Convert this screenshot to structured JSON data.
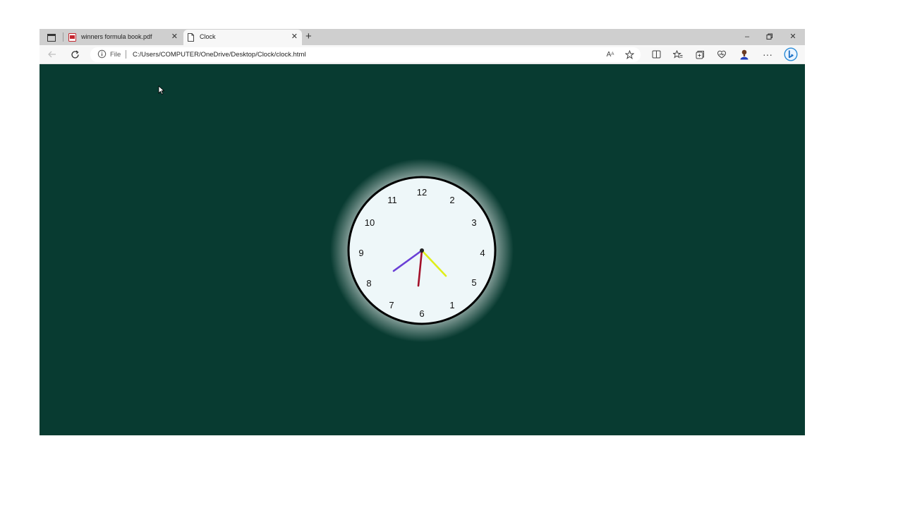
{
  "browser": {
    "tabs": [
      {
        "label": "winners formula book.pdf",
        "icon": "pdf-icon",
        "active": false
      },
      {
        "label": "Clock",
        "icon": "page-icon",
        "active": true
      }
    ],
    "new_tab_icon": "plus-icon",
    "address": {
      "scheme_label": "File",
      "url": "C:/Users/COMPUTER/OneDrive/Desktop/Clock/clock.html"
    },
    "toolbar_icons": [
      "back-icon",
      "refresh-icon",
      "read-aloud-icon",
      "favorite-star-icon",
      "split-screen-icon",
      "favorites-icon",
      "collections-icon",
      "browser-essentials-icon",
      "profile-icon",
      "more-icon",
      "bing-icon"
    ]
  },
  "page": {
    "background_color": "#083b31",
    "clock": {
      "face_color": "#eef7f9",
      "rim_color": "#000000",
      "numerals": [
        "12",
        "1",
        "2",
        "3",
        "4",
        "5",
        "6",
        "7",
        "8",
        "9",
        "10",
        "11"
      ],
      "hands": [
        {
          "name": "hour",
          "color": "#6a3fd6"
        },
        {
          "name": "minute",
          "color": "#e0ee1a"
        },
        {
          "name": "second",
          "color": "#a3102a"
        }
      ]
    }
  }
}
